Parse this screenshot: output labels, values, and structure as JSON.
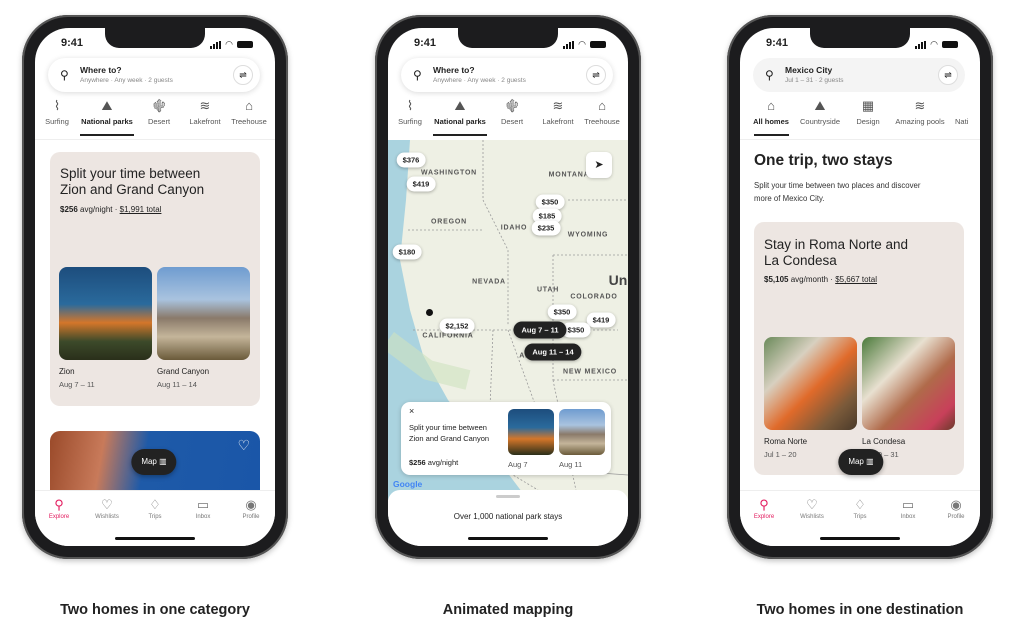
{
  "status_time": "9:41",
  "tabbar": [
    {
      "label": "Explore",
      "icon": "search-icon"
    },
    {
      "label": "Wishlists",
      "icon": "heart-icon"
    },
    {
      "label": "Trips",
      "icon": "airbnb-logo-icon"
    },
    {
      "label": "Inbox",
      "icon": "message-icon"
    },
    {
      "label": "Profile",
      "icon": "profile-icon"
    }
  ],
  "accent": "#e31c5f",
  "phone1": {
    "search": {
      "title": "Where to?",
      "sub": "Anywhere · Any week · 2 guests"
    },
    "categories": [
      {
        "label": "Surfing"
      },
      {
        "label": "National parks"
      },
      {
        "label": "Desert"
      },
      {
        "label": "Lakefront"
      },
      {
        "label": "Treehouse"
      }
    ],
    "card": {
      "title": "Split your time between Zion and Grand Canyon",
      "price": "$256",
      "price_unit": "avg/night ·",
      "total": "$1,991 total",
      "stays": [
        {
          "name": "Zion",
          "dates": "Aug 7 – 11"
        },
        {
          "name": "Grand Canyon",
          "dates": "Aug 11 – 14"
        }
      ]
    },
    "map_button": "Map",
    "caption": "Two homes in one category"
  },
  "phone2": {
    "search": {
      "title": "Where to?",
      "sub": "Anywhere · Any week · 2 guests"
    },
    "categories": [
      {
        "label": "Surfing"
      },
      {
        "label": "National parks"
      },
      {
        "label": "Desert"
      },
      {
        "label": "Lakefront"
      },
      {
        "label": "Treehouse"
      }
    ],
    "states": [
      "WASHINGTON",
      "MONTANA",
      "OREGON",
      "IDAHO",
      "WYOMING",
      "NEVADA",
      "UTAH",
      "COLORADO",
      "CALIFORNIA",
      "ARIZONA",
      "NEW MEXICO",
      "Un"
    ],
    "pins": [
      "$376",
      "$419",
      "$350",
      "$185",
      "$235",
      "$180",
      "$350",
      "$419",
      "$350",
      "$2,152"
    ],
    "trip_pins": [
      "Aug 7 – 11",
      "Aug 11 – 14"
    ],
    "card": {
      "title": "Split your time between Zion and Grand Canyon",
      "price": "$256",
      "price_unit": "avg/night",
      "dates": [
        "Aug 7",
        "Aug 11"
      ]
    },
    "google": "Google",
    "sheet_text": "Over 1,000 national park stays",
    "caption": "Animated mapping"
  },
  "phone3": {
    "search": {
      "title": "Mexico City",
      "sub": "Jul 1 – 31 · 2 guests"
    },
    "categories": [
      {
        "label": "All homes"
      },
      {
        "label": "Countryside"
      },
      {
        "label": "Design"
      },
      {
        "label": "Amazing pools"
      },
      {
        "label": "Nati"
      }
    ],
    "heading": "One trip, two stays",
    "desc": "Split your time between two places and discover more of Mexico City.",
    "card": {
      "title": "Stay in Roma Norte and La Condesa",
      "price": "$5,105",
      "price_unit": "avg/month ·",
      "total": "$5,667 total",
      "stays": [
        {
          "name": "Roma Norte",
          "dates": "Jul 1 – 20"
        },
        {
          "name": "La Condesa",
          "dates": "Jul 20 – 31"
        }
      ]
    },
    "map_button": "Map",
    "caption": "Two homes in one destination"
  }
}
